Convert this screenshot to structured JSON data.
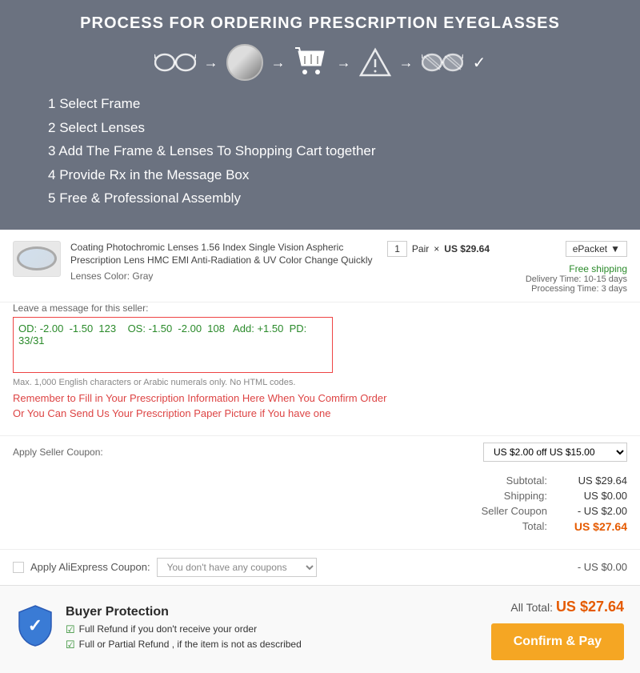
{
  "header": {
    "title": "PROCESS FOR ORDERING PRESCRIPTION EYEGLASSES",
    "steps": [
      {
        "label": "Select Frame",
        "icon": "glasses"
      },
      {
        "label": "Select Lenses",
        "icon": "lens"
      },
      {
        "label": "Add to Cart",
        "icon": "cart"
      },
      {
        "label": "Provide Rx",
        "icon": "triangle"
      },
      {
        "label": "Assembly",
        "icon": "glasses-striped"
      }
    ],
    "list": [
      {
        "number": "1",
        "text": "Select Frame"
      },
      {
        "number": "2",
        "text": "Select Lenses"
      },
      {
        "number": "3",
        "text": "Add The Frame & Lenses To Shopping Cart together"
      },
      {
        "number": "4",
        "text": "Provide Rx in the Message Box"
      },
      {
        "number": "5",
        "text": "Free & Professional Assembly"
      }
    ]
  },
  "order": {
    "item_name": "Coating Photochromic Lenses 1.56 Index Single Vision Aspheric Prescription Lens HMC EMI Anti-Radiation & UV Color Change Quickly",
    "lenses_color_label": "Lenses Color:",
    "lenses_color": "Gray",
    "qty": "1",
    "unit": "Pair",
    "price": "US $29.64",
    "shipping_method": "ePacket",
    "free_shipping": "Free shipping",
    "delivery_time_label": "Delivery Time:",
    "delivery_time": "10-15 days",
    "processing_time_label": "Processing Time:",
    "processing_time": "3 days"
  },
  "message": {
    "label": "Leave a message for this seller:",
    "content": "OD: -2.00  -1.50  123    OS: -1.50  -2.00  108   Add: +1.50  PD: 33/31",
    "hint": "Max. 1,000 English characters or Arabic numerals only. No HTML codes."
  },
  "reminder": {
    "text1": "Remember to Fill in Your Prescription Information Here When You Comfirm Order",
    "text2": "Or You Can Send Us Your Prescription Paper Picture if You have one"
  },
  "coupon": {
    "label": "Apply Seller Coupon:",
    "value": "US $2.00 off US $15.00"
  },
  "totals": {
    "subtotal_label": "Subtotal:",
    "subtotal": "US $29.64",
    "shipping_label": "Shipping:",
    "shipping": "US $0.00",
    "seller_coupon_label": "Seller Coupon",
    "seller_coupon": "- US $2.00",
    "total_label": "Total:",
    "total": "US $27.64"
  },
  "ali_coupon": {
    "label": "Apply AliExpress Coupon:",
    "placeholder": "You don't have any coupons",
    "amount": "- US $0.00"
  },
  "bottom": {
    "protection_title": "Buyer Protection",
    "protection_items": [
      "Full Refund if you don't receive your order",
      "Full or Partial Refund , if the item is not as described"
    ],
    "all_total_label": "All Total:",
    "all_total": "US $27.64",
    "confirm_label": "Confirm & Pay"
  }
}
